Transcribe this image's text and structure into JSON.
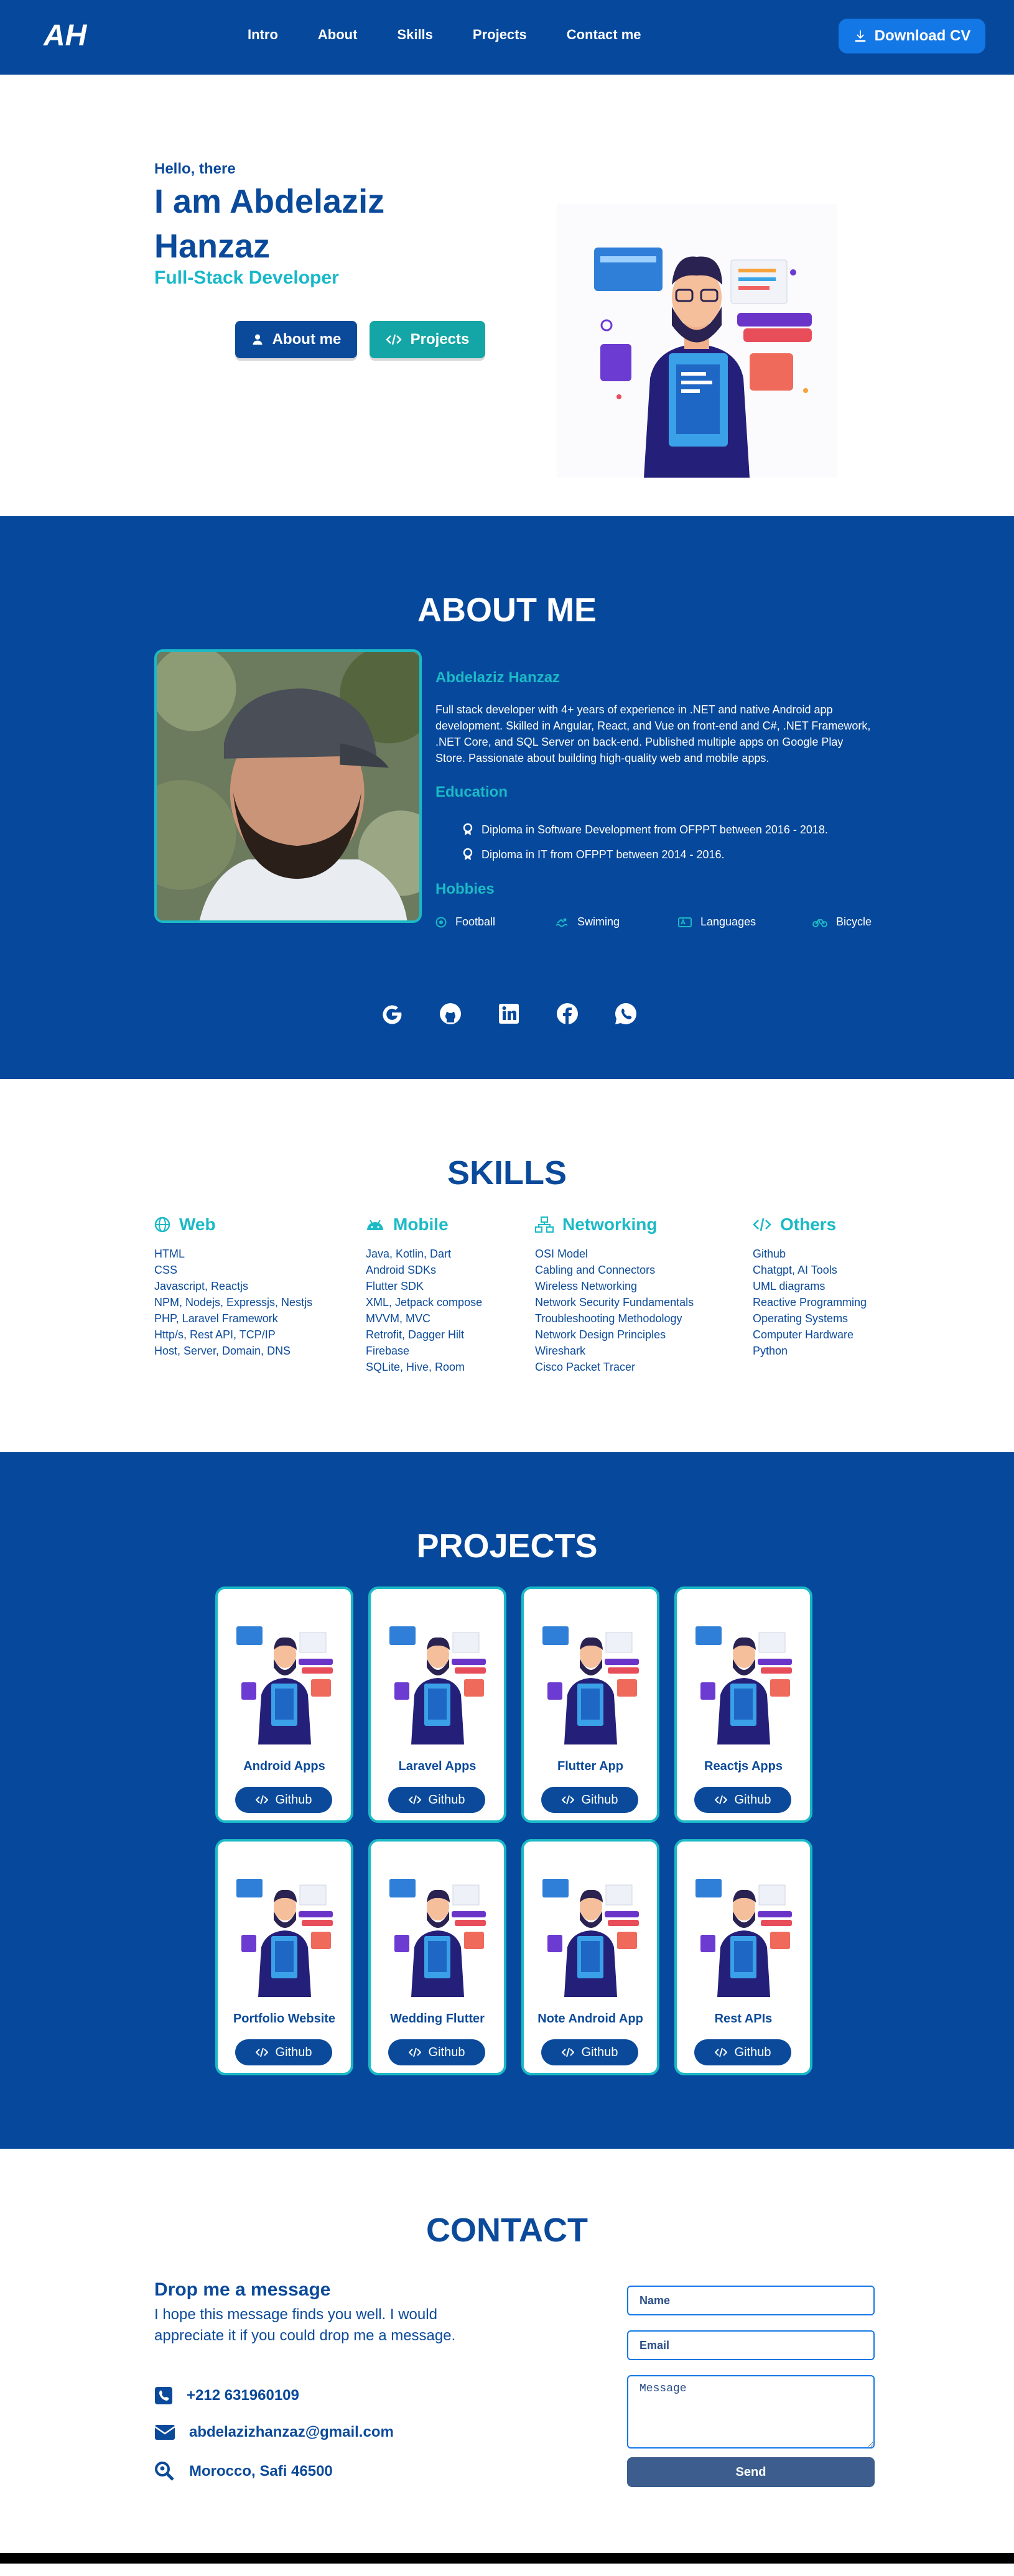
{
  "navbar": {
    "logo": "AH",
    "links": [
      "Intro",
      "About",
      "Skills",
      "Projects",
      "Contact me"
    ],
    "download_label": "Download CV"
  },
  "hero": {
    "greeting": "Hello, there",
    "name": "I am Abdelaziz Hanzaz",
    "role": "Full-Stack Developer",
    "about_button": "About me",
    "projects_button": "Projects"
  },
  "about": {
    "title": "ABOUT ME",
    "name": "Abdelaziz Hanzaz",
    "bio": "Full stack developer with 4+ years of experience in .NET and native Android app development. Skilled in Angular, React, and Vue on front-end and C#, .NET Framework, .NET Core, and SQL Server on back-end. Published multiple apps on Google Play Store. Passionate about building high-quality web and mobile apps.",
    "education_title": "Education",
    "education": [
      "Diploma in Software Development from OFPPT between 2016 - 2018.",
      "Diploma in IT from OFPPT between 2014 - 2016."
    ],
    "hobbies_title": "Hobbies",
    "hobbies": [
      "Football",
      "Swiming",
      "Languages",
      "Bicycle"
    ]
  },
  "skills": {
    "title": "SKILLS",
    "columns": [
      {
        "name": "Web",
        "items": [
          "HTML",
          "CSS",
          "Javascript, Reactjs",
          "NPM, Nodejs, Expressjs, Nestjs",
          "PHP, Laravel Framework",
          "Http/s, Rest API, TCP/IP",
          "Host, Server, Domain, DNS"
        ]
      },
      {
        "name": "Mobile",
        "items": [
          "Java, Kotlin, Dart",
          "Android SDKs",
          "Flutter SDK",
          "XML, Jetpack compose",
          "MVVM, MVC",
          "Retrofit, Dagger Hilt",
          "Firebase",
          "SQLite, Hive, Room"
        ]
      },
      {
        "name": "Networking",
        "items": [
          "OSI Model",
          "Cabling and Connectors",
          "Wireless Networking",
          "Network Security Fundamentals",
          "Troubleshooting Methodology",
          "Network Design Principles",
          "Wireshark",
          "Cisco Packet Tracer"
        ]
      },
      {
        "name": "Others",
        "items": [
          "Github",
          "Chatgpt, AI Tools",
          "UML diagrams",
          "Reactive Programming",
          "Operating Systems",
          "Computer Hardware",
          "Python"
        ]
      }
    ]
  },
  "projects": {
    "title": "PROJECTS",
    "button_label": "Github",
    "items": [
      "Android Apps",
      "Laravel Apps",
      "Flutter App",
      "Reactjs Apps",
      "Portfolio Website",
      "Wedding Flutter",
      "Note Android App",
      "Rest APIs"
    ]
  },
  "contact": {
    "title": "CONTACT",
    "heading": "Drop me a message",
    "text": "I hope this message finds you well. I would appreciate it if you could drop me a message.",
    "phone": "+212 631960109",
    "email": "abdelazizhanzaz@gmail.com",
    "location": "Morocco, Safi 46500",
    "name_placeholder": "Name",
    "email_placeholder": "Email",
    "message_placeholder": "Message",
    "send_label": "Send"
  },
  "colors": {
    "primary": "#06489b",
    "accent": "#1bbac6",
    "button_blue": "#1477e6"
  }
}
